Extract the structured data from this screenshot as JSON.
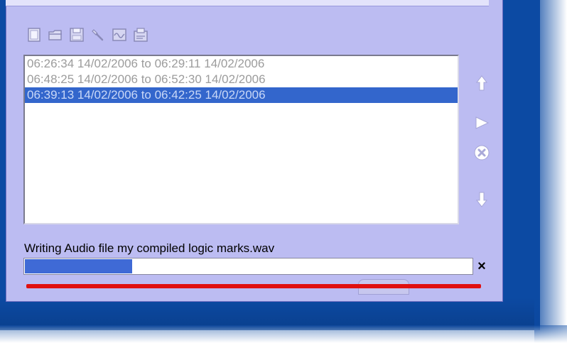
{
  "window": {
    "toolbar": {
      "buttons": [
        {
          "name": "new-icon"
        },
        {
          "name": "open-folder-icon"
        },
        {
          "name": "save-icon"
        },
        {
          "name": "tools-icon"
        },
        {
          "name": "waveform-icon"
        },
        {
          "name": "export-icon"
        }
      ]
    },
    "list": {
      "items": [
        {
          "text": "06:26:34 14/02/2006 to 06:29:11 14/02/2006",
          "selected": false
        },
        {
          "text": "06:48:25 14/02/2006 to 06:52:30 14/02/2006",
          "selected": false
        },
        {
          "text": "06:39:13 14/02/2006 to 06:42:25 14/02/2006",
          "selected": true
        }
      ]
    },
    "side_controls": [
      "move-up-icon",
      "play-icon",
      "delete-icon",
      "move-down-icon"
    ],
    "status": {
      "text": "Writing Audio file my compiled logic marks.wav",
      "progress_fraction": 0.24,
      "cancel_label": "×"
    },
    "colors": {
      "panel": "#bcbcf2",
      "selection": "#3366cc",
      "progress": "#3f6ad6",
      "accent_line": "#e01010",
      "desktop": "#0c4aa3"
    }
  }
}
